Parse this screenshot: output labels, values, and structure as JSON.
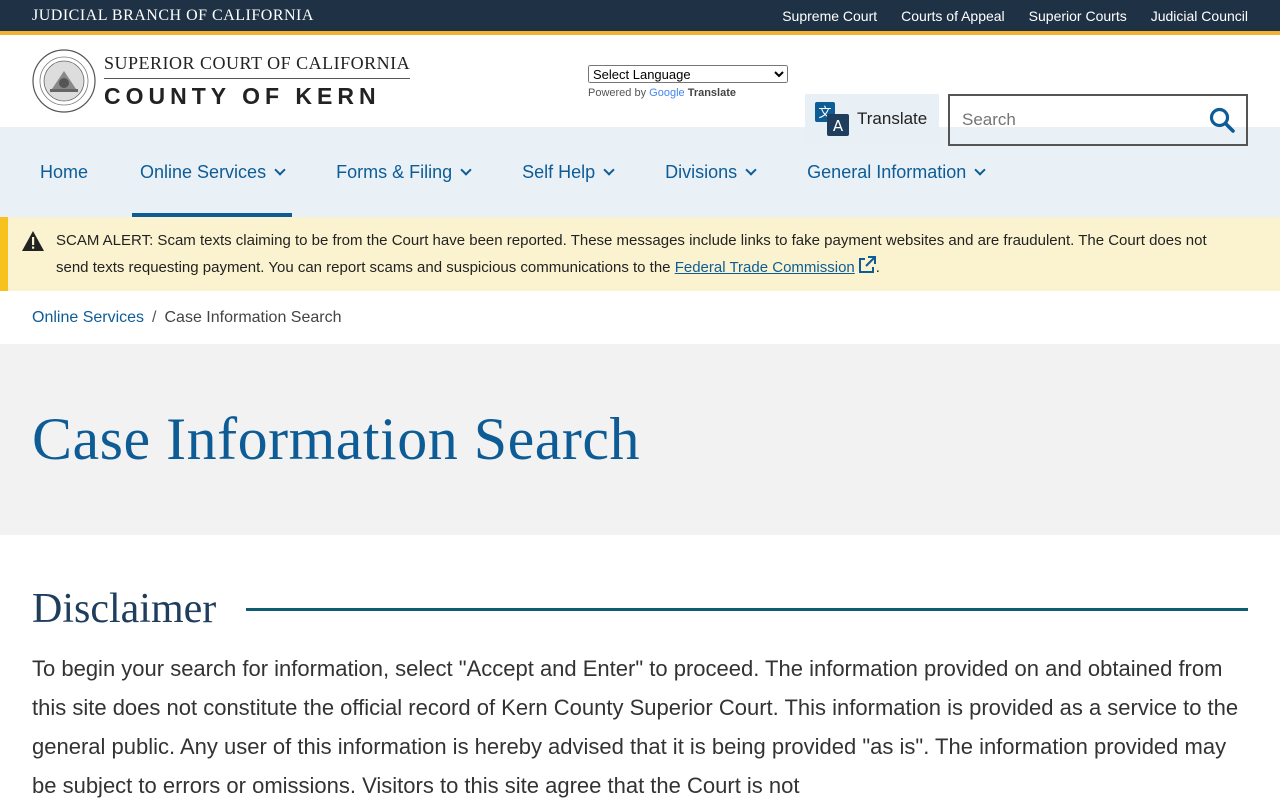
{
  "utility_bar": {
    "brand": "JUDICIAL BRANCH OF CALIFORNIA",
    "links": [
      "Supreme Court",
      "Courts of Appeal",
      "Superior Courts",
      "Judicial Council"
    ]
  },
  "header": {
    "logo_line1": "SUPERIOR COURT OF CALIFORNIA",
    "logo_line2": "COUNTY OF KERN",
    "language_select": "Select Language",
    "powered_by": "Powered by",
    "google_label": "Google",
    "translate_word": "Translate",
    "translate_button": "Translate",
    "search_placeholder": "Search"
  },
  "nav": {
    "items": [
      {
        "label": "Home"
      },
      {
        "label": "Online Services"
      },
      {
        "label": "Forms & Filing"
      },
      {
        "label": "Self Help"
      },
      {
        "label": "Divisions"
      },
      {
        "label": "General Information"
      }
    ]
  },
  "alert": {
    "prefix": "SCAM ALERT:",
    "text": " Scam texts claiming to be from the Court have been reported. These messages include links to fake payment websites and are fraudulent. The Court does not send texts requesting payment. You can report scams and suspicious communications to the ",
    "link": "Federal Trade Commission",
    "suffix": "."
  },
  "breadcrumb": {
    "parent": "Online Services",
    "separator": "/",
    "current": "Case Information Search"
  },
  "hero": {
    "title": "Case Information Search"
  },
  "content": {
    "heading": "Disclaimer",
    "paragraph": "To begin your search for information, select \"Accept and Enter\" to proceed. The information provided on and obtained from this site does not constitute the official record of Kern County Superior Court. This information is provided as a service to the general public. Any user of this information is hereby advised that it is being provided \"as is\". The information provided may be subject to errors or omissions. Visitors to this site agree that the Court is not"
  },
  "colors": {
    "accent": "#0e5c96",
    "utility_bg": "#1f3145",
    "gold": "#f2b233",
    "alert_bg": "#fbf3d0"
  }
}
